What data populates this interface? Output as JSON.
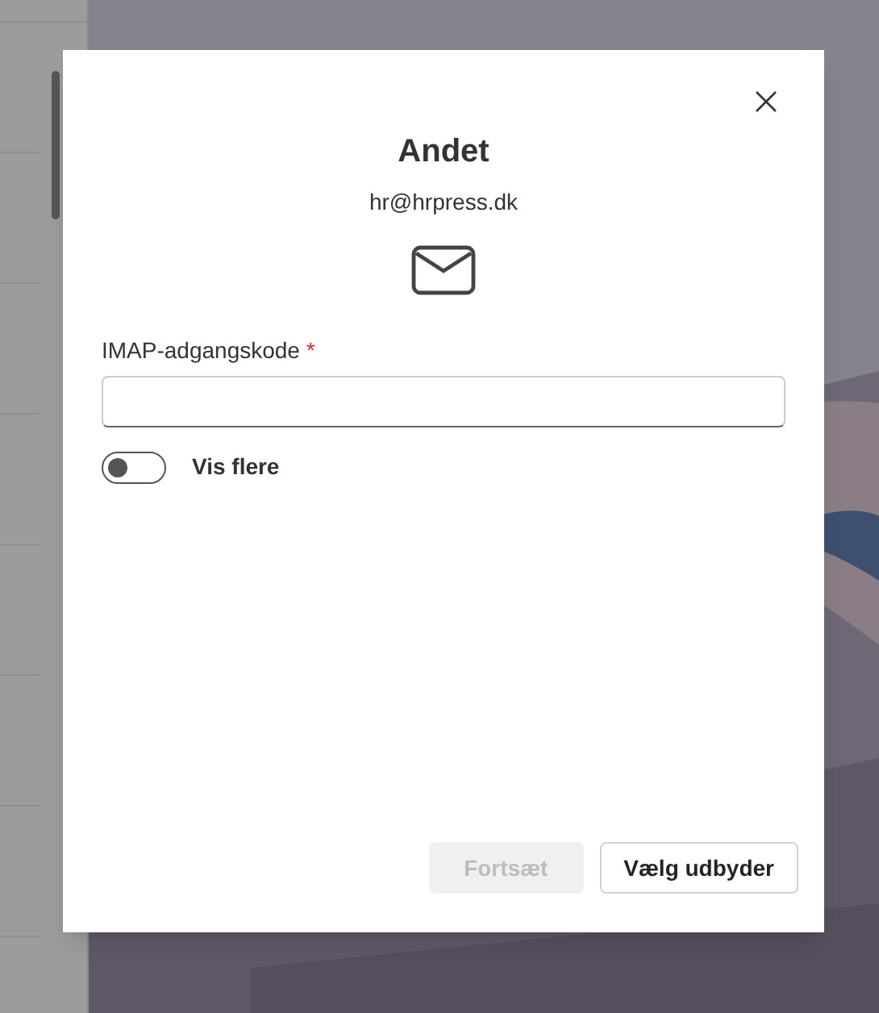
{
  "dialog": {
    "title": "Andet",
    "email": "hr@hrpress.dk",
    "field": {
      "label": "IMAP-adgangskode",
      "required_mark": "*"
    },
    "toggle": {
      "label": "Vis flere",
      "on": false
    },
    "buttons": [
      {
        "label": "Fortsæt",
        "disabled": true
      },
      {
        "label": "Vælg udbyder",
        "disabled": false
      }
    ]
  }
}
